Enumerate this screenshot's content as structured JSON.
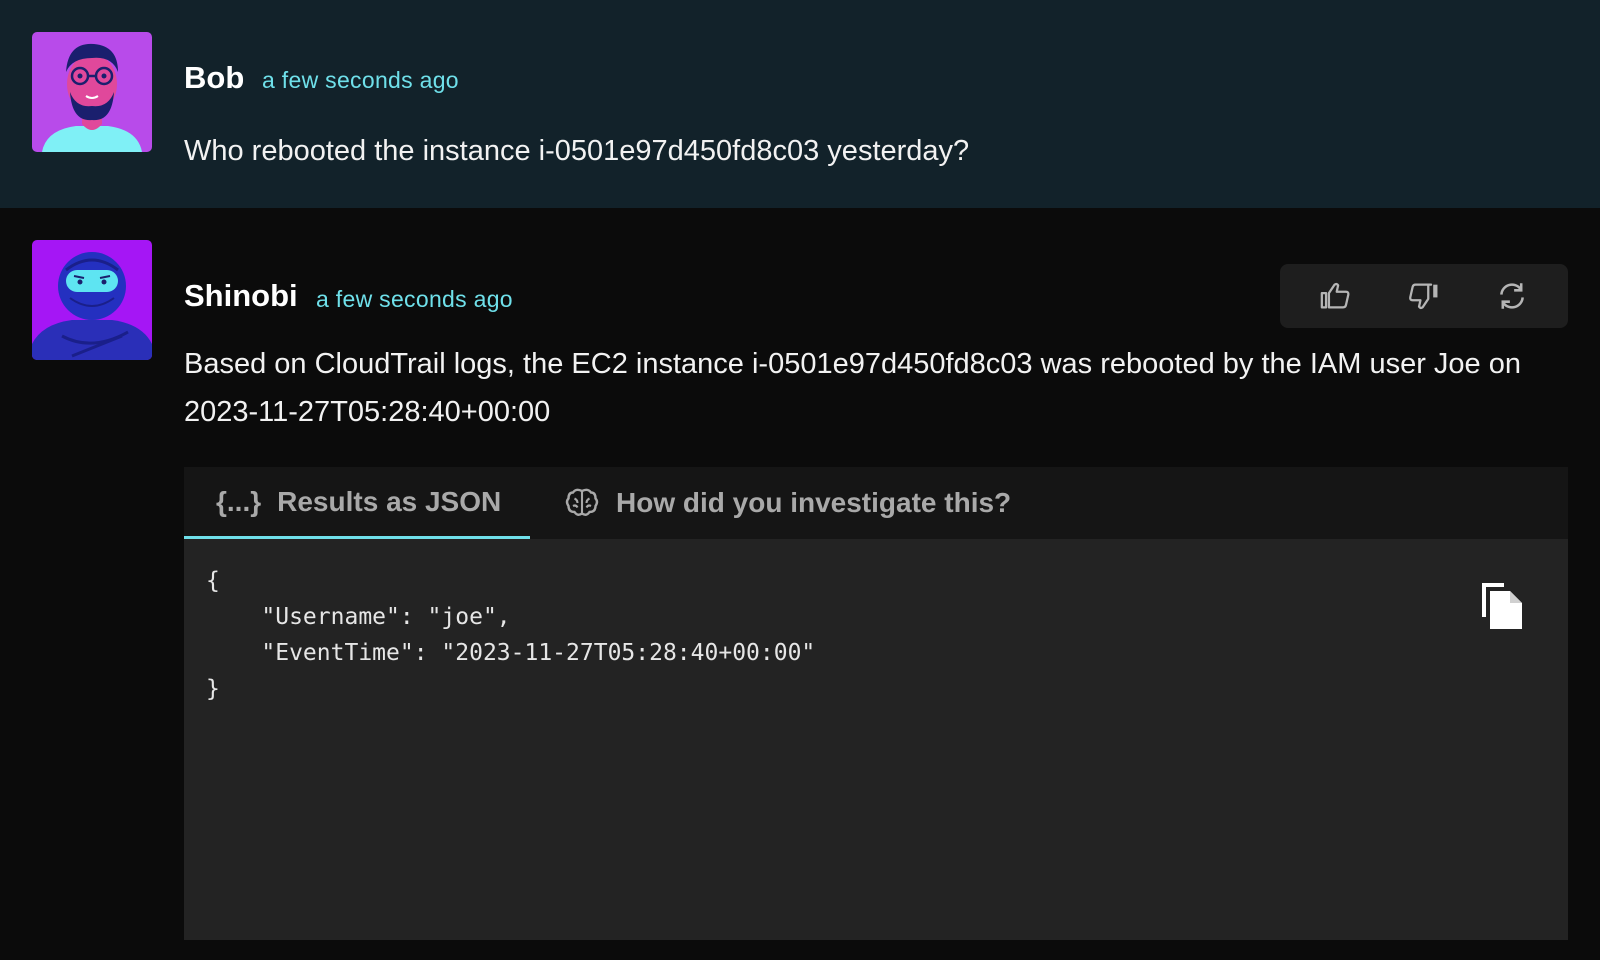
{
  "messages": [
    {
      "author": "Bob",
      "time": "a few seconds ago",
      "text": "Who rebooted the instance i-0501e97d450fd8c03 yesterday?",
      "avatar": "bearded-man-avatar"
    },
    {
      "author": "Shinobi",
      "time": "a few seconds ago",
      "text": "Based on CloudTrail logs, the EC2 instance i-0501e97d450fd8c03 was rebooted by the IAM user Joe on 2023-11-27T05:28:40+00:00",
      "avatar": "ninja-avatar",
      "feedback": {
        "icons": [
          "thumbs-up-icon",
          "thumbs-down-icon",
          "refresh-icon"
        ]
      },
      "panel": {
        "tabs": [
          {
            "label": "Results as JSON",
            "icon_text": "{...}",
            "icon": "braces-icon",
            "active": true
          },
          {
            "label": "How did you investigate this?",
            "icon": "brain-icon",
            "active": false
          }
        ],
        "code": "{\n    \"Username\": \"joe\",\n    \"EventTime\": \"2023-11-27T05:28:40+00:00\"\n}",
        "copy_icon": "copy-icon"
      }
    }
  ],
  "colors": {
    "user_message_bg": "#12222a",
    "bot_message_bg": "#0b0b0b",
    "timestamp": "#6fe0ea",
    "active_tab_underline": "#6fe0ea",
    "code_bg": "#232323",
    "tabs_bg": "#151515",
    "feedback_bar_bg": "#1e1e1e"
  }
}
